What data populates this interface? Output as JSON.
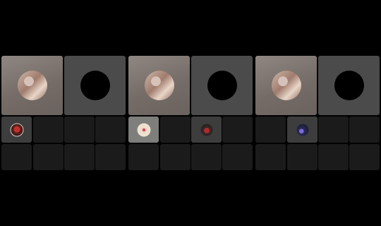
{
  "panels": [
    {
      "id": "panel-1",
      "big_tiles": [
        {
          "kind": "participant-video",
          "avatar": "user-photo-avatar"
        },
        {
          "kind": "participant-placeholder",
          "avatar": "empty-avatar-circle"
        }
      ],
      "small_tiles": [
        {
          "state": "active",
          "avatar": "red-photo-avatar"
        },
        {
          "state": "empty"
        },
        {
          "state": "empty"
        },
        {
          "state": "empty"
        },
        {
          "state": "empty"
        },
        {
          "state": "empty"
        },
        {
          "state": "empty"
        },
        {
          "state": "empty"
        }
      ]
    },
    {
      "id": "panel-2",
      "big_tiles": [
        {
          "kind": "participant-video",
          "avatar": "user-photo-avatar"
        },
        {
          "kind": "participant-placeholder",
          "avatar": "empty-avatar-circle"
        }
      ],
      "small_tiles": [
        {
          "state": "active-light",
          "avatar": "paper-avatar"
        },
        {
          "state": "empty"
        },
        {
          "state": "active",
          "avatar": "red-object-avatar"
        },
        {
          "state": "empty"
        },
        {
          "state": "empty"
        },
        {
          "state": "empty"
        },
        {
          "state": "empty"
        },
        {
          "state": "empty"
        }
      ]
    },
    {
      "id": "panel-3",
      "big_tiles": [
        {
          "kind": "participant-video",
          "avatar": "user-photo-avatar"
        },
        {
          "kind": "participant-placeholder",
          "avatar": "empty-avatar-circle"
        }
      ],
      "small_tiles": [
        {
          "state": "empty"
        },
        {
          "state": "active",
          "avatar": "blue-avatar"
        },
        {
          "state": "empty"
        },
        {
          "state": "empty"
        },
        {
          "state": "empty"
        },
        {
          "state": "empty"
        },
        {
          "state": "empty"
        },
        {
          "state": "empty"
        }
      ]
    }
  ]
}
